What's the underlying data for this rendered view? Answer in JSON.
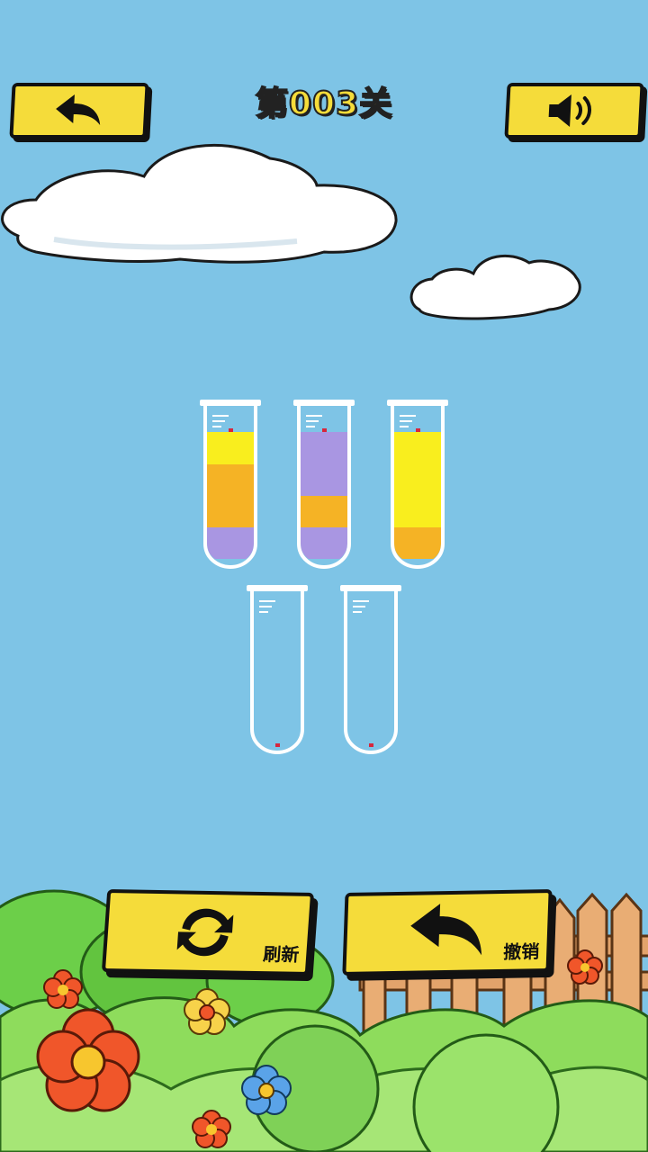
{
  "header": {
    "level_title": "第003关",
    "back_icon": "back-arrow-icon",
    "sound_icon": "speaker-icon"
  },
  "colors": {
    "yellow": "#f9ee1e",
    "orange": "#f5b325",
    "purple": "#a996e2",
    "button": "#f5dc3a",
    "sky": "#7ec4e6"
  },
  "tubes": [
    {
      "id": "tube-1",
      "layers_bottom_to_top": [
        "purple",
        "orange",
        "orange",
        "yellow"
      ]
    },
    {
      "id": "tube-2",
      "layers_bottom_to_top": [
        "purple",
        "orange",
        "purple",
        "purple"
      ]
    },
    {
      "id": "tube-3",
      "layers_bottom_to_top": [
        "orange",
        "yellow",
        "yellow",
        "yellow"
      ]
    },
    {
      "id": "tube-4",
      "layers_bottom_to_top": []
    },
    {
      "id": "tube-5",
      "layers_bottom_to_top": []
    }
  ],
  "footer": {
    "refresh_label": "刷新",
    "refresh_icon": "refresh-icon",
    "undo_label": "撤销",
    "undo_icon": "undo-arrow-icon"
  }
}
